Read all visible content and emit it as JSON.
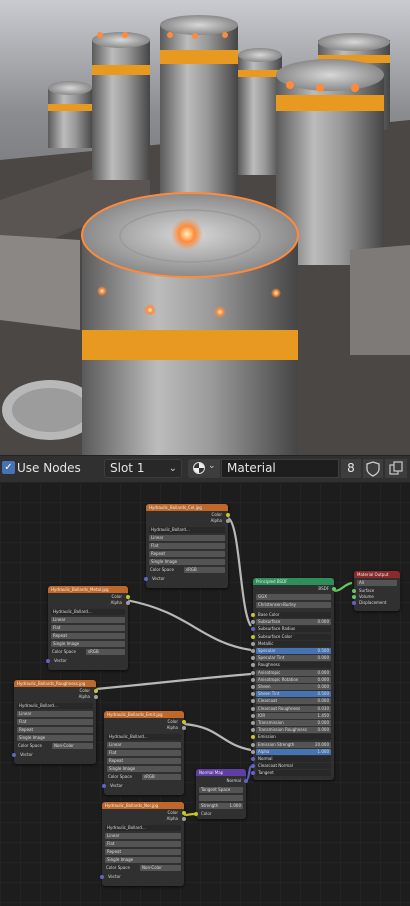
{
  "toolbar": {
    "use_nodes_checked": true,
    "use_nodes_label": "Use Nodes",
    "slot_label": "Slot 1",
    "material_name": "Material",
    "user_count": "8"
  },
  "nodes": {
    "tex_ao": {
      "title": "Hydraulic_Bollards_Col.jpg",
      "out_color": "Color",
      "out_alpha": "Alpha",
      "image_name": "Hydraulic_Bollard...",
      "interpolation": "Linear",
      "projection": "Flat",
      "extension": "Repeat",
      "source": "Single Image",
      "colorspace_label": "Color Space",
      "colorspace_value": "sRGB",
      "in_vector": "Vector"
    },
    "tex_metal": {
      "title": "Hydraulic_Bollards_Metal.jpg",
      "out_color": "Color",
      "out_alpha": "Alpha",
      "image_name": "Hydraulic_Bollard...",
      "interpolation": "Linear",
      "projection": "Flat",
      "extension": "Repeat",
      "source": "Single Image",
      "colorspace_label": "Color Space",
      "colorspace_value": "sRGB",
      "in_vector": "Vector"
    },
    "tex_rough": {
      "title": "Hydraulic_Bollards_Roughness.jpg",
      "out_color": "Color",
      "out_alpha": "Alpha",
      "image_name": "Hydraulic_Bollard...",
      "interpolation": "Linear",
      "projection": "Flat",
      "extension": "Repeat",
      "source": "Single Image",
      "colorspace_label": "Color Space",
      "colorspace_value": "Non-Color",
      "in_vector": "Vector"
    },
    "tex_emit": {
      "title": "Hydraulic_Bollards_Emit.jpg",
      "out_color": "Color",
      "out_alpha": "Alpha",
      "image_name": "Hydraulic_Bollard...",
      "interpolation": "Linear",
      "projection": "Flat",
      "extension": "Repeat",
      "source": "Single Image",
      "colorspace_label": "Color Space",
      "colorspace_value": "sRGB",
      "in_vector": "Vector"
    },
    "tex_normal": {
      "title": "Hydraulic_Bollards_Nor.jpg",
      "out_color": "Color",
      "out_alpha": "Alpha",
      "image_name": "Hydraulic_Bollard...",
      "interpolation": "Linear",
      "projection": "Flat",
      "extension": "Repeat",
      "source": "Single Image",
      "colorspace_label": "Color Space",
      "colorspace_value": "Non-Color",
      "in_vector": "Vector"
    },
    "normal_map": {
      "title": "Normal Map",
      "out_normal": "Normal",
      "space": "Tangent Space",
      "strength_label": "Strength",
      "strength_value": "1.000",
      "in_color": "Color"
    },
    "bsdf": {
      "title": "Principled BSDF",
      "out_bsdf": "BSDF",
      "distribution": "GGX",
      "subsurface_method": "Christensen-Burley",
      "rows": [
        {
          "label": "Base Color",
          "value": ""
        },
        {
          "label": "Subsurface",
          "value": "0.000"
        },
        {
          "label": "Subsurface Radius",
          "value": ""
        },
        {
          "label": "Subsurface Color",
          "value": ""
        },
        {
          "label": "Metallic",
          "value": ""
        },
        {
          "label": "Specular",
          "value": "0.500"
        },
        {
          "label": "Specular Tint",
          "value": "0.000"
        },
        {
          "label": "Roughness",
          "value": ""
        },
        {
          "label": "Anisotropic",
          "value": "0.000"
        },
        {
          "label": "Anisotropic Rotation",
          "value": "0.000"
        },
        {
          "label": "Sheen",
          "value": "0.000"
        },
        {
          "label": "Sheen Tint",
          "value": "0.500"
        },
        {
          "label": "Clearcoat",
          "value": "0.000"
        },
        {
          "label": "Clearcoat Roughness",
          "value": "0.030"
        },
        {
          "label": "IOR",
          "value": "1.450"
        },
        {
          "label": "Transmission",
          "value": "0.000"
        },
        {
          "label": "Transmission Roughness",
          "value": "0.000"
        },
        {
          "label": "Emission",
          "value": ""
        },
        {
          "label": "Emission Strength",
          "value": "20.000"
        },
        {
          "label": "Alpha",
          "value": "1.000"
        },
        {
          "label": "Normal",
          "value": ""
        },
        {
          "label": "Clearcoat Normal",
          "value": ""
        },
        {
          "label": "Tangent",
          "value": ""
        }
      ]
    },
    "output": {
      "title": "Material Output",
      "target": "All",
      "in_surface": "Surface",
      "in_volume": "Volume",
      "in_displacement": "Displacement"
    }
  },
  "colors": {
    "texture_header": "#c0682a",
    "bsdf_header": "#2d8f5a",
    "output_header": "#8a2a2a",
    "vector_header": "#5f3fa6",
    "accent": "#4772b3",
    "bollard_light": "#ff8a3a",
    "bollard_stripe": "#e89a20"
  }
}
